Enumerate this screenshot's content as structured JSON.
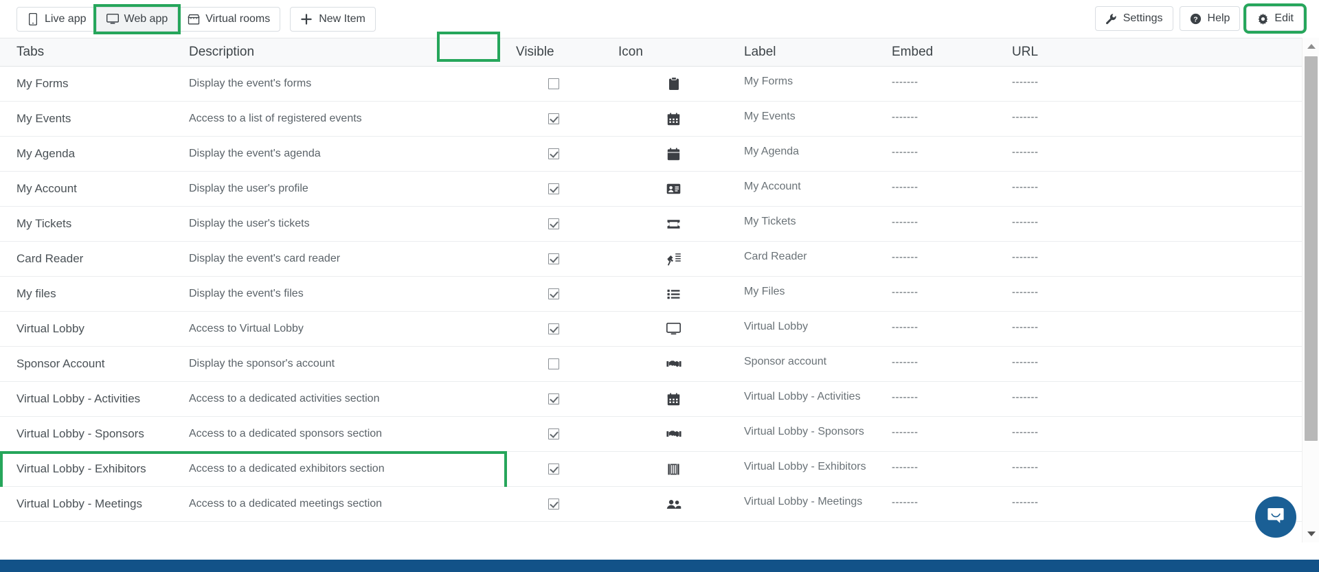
{
  "toolbar": {
    "left_buttons": [
      {
        "label": "Live app",
        "icon": "mobile-icon",
        "active": false,
        "highlighted": false
      },
      {
        "label": "Web app",
        "icon": "monitor-icon",
        "active": true,
        "highlighted": true
      },
      {
        "label": "Virtual rooms",
        "icon": "store-icon",
        "active": false,
        "highlighted": false
      }
    ],
    "new_item": {
      "label": "New Item",
      "icon": "plus-icon"
    },
    "right_buttons": [
      {
        "label": "Settings",
        "icon": "wrench-icon",
        "highlighted": false
      },
      {
        "label": "Help",
        "icon": "question-icon",
        "highlighted": false
      },
      {
        "label": "Edit",
        "icon": "gear-icon",
        "highlighted": true
      }
    ]
  },
  "table": {
    "headers": {
      "tabs": "Tabs",
      "description": "Description",
      "visible": "Visible",
      "icon": "Icon",
      "label": "Label",
      "embed": "Embed",
      "url": "URL"
    },
    "highlighted_header": "Visible",
    "rows": [
      {
        "tab": "My Forms",
        "description": "Display the event's forms",
        "visible": false,
        "icon": "clipboard-icon",
        "label": "My Forms",
        "embed": "-------",
        "url": "-------",
        "highlighted": false
      },
      {
        "tab": "My Events",
        "description": "Access to a list of registered events",
        "visible": true,
        "icon": "calendar-icon",
        "label": "My Events",
        "embed": "-------",
        "url": "-------",
        "highlighted": false
      },
      {
        "tab": "My Agenda",
        "description": "Display the event's agenda",
        "visible": true,
        "icon": "agenda-icon",
        "label": "My Agenda",
        "embed": "-------",
        "url": "-------",
        "highlighted": false
      },
      {
        "tab": "My Account",
        "description": "Display the user's profile",
        "visible": true,
        "icon": "id-card-icon",
        "label": "My Account",
        "embed": "-------",
        "url": "-------",
        "highlighted": false
      },
      {
        "tab": "My Tickets",
        "description": "Display the user's tickets",
        "visible": true,
        "icon": "ticket-icon",
        "label": "My Tickets",
        "embed": "-------",
        "url": "-------",
        "highlighted": false
      },
      {
        "tab": "Card Reader",
        "description": "Display the event's card reader",
        "visible": true,
        "icon": "scanner-icon",
        "label": "Card Reader",
        "embed": "-------",
        "url": "-------",
        "highlighted": false
      },
      {
        "tab": "My files",
        "description": "Display the event's files",
        "visible": true,
        "icon": "list-icon",
        "label": "My Files",
        "embed": "-------",
        "url": "-------",
        "highlighted": false
      },
      {
        "tab": "Virtual Lobby",
        "description": "Access to Virtual Lobby",
        "visible": true,
        "icon": "monitor-icon",
        "label": "Virtual Lobby",
        "embed": "-------",
        "url": "-------",
        "highlighted": false
      },
      {
        "tab": "Sponsor Account",
        "description": "Display the sponsor's account",
        "visible": false,
        "icon": "handshake-icon",
        "label": "Sponsor account",
        "embed": "-------",
        "url": "-------",
        "highlighted": false
      },
      {
        "tab": "Virtual Lobby - Activities",
        "description": "Access to a dedicated activities section",
        "visible": true,
        "icon": "calendar-icon",
        "label": "Virtual Lobby - Activities",
        "embed": "-------",
        "url": "-------",
        "highlighted": false
      },
      {
        "tab": "Virtual Lobby - Sponsors",
        "description": "Access to a dedicated sponsors section",
        "visible": true,
        "icon": "handshake-icon",
        "label": "Virtual Lobby - Sponsors",
        "embed": "-------",
        "url": "-------",
        "highlighted": false
      },
      {
        "tab": "Virtual Lobby - Exhibitors",
        "description": "Access to a dedicated exhibitors section",
        "visible": true,
        "icon": "booth-icon",
        "label": "Virtual Lobby - Exhibitors",
        "embed": "-------",
        "url": "-------",
        "highlighted": true
      },
      {
        "tab": "Virtual Lobby - Meetings",
        "description": "Access to a dedicated meetings section",
        "visible": true,
        "icon": "people-icon",
        "label": "Virtual Lobby - Meetings",
        "embed": "-------",
        "url": "-------",
        "highlighted": false
      }
    ]
  },
  "chat": {
    "icon": "chat-bubble-icon"
  },
  "colors": {
    "highlight_green": "#26a65b",
    "bottom_bar_blue": "#125288",
    "chat_blue": "#1a5f95"
  }
}
